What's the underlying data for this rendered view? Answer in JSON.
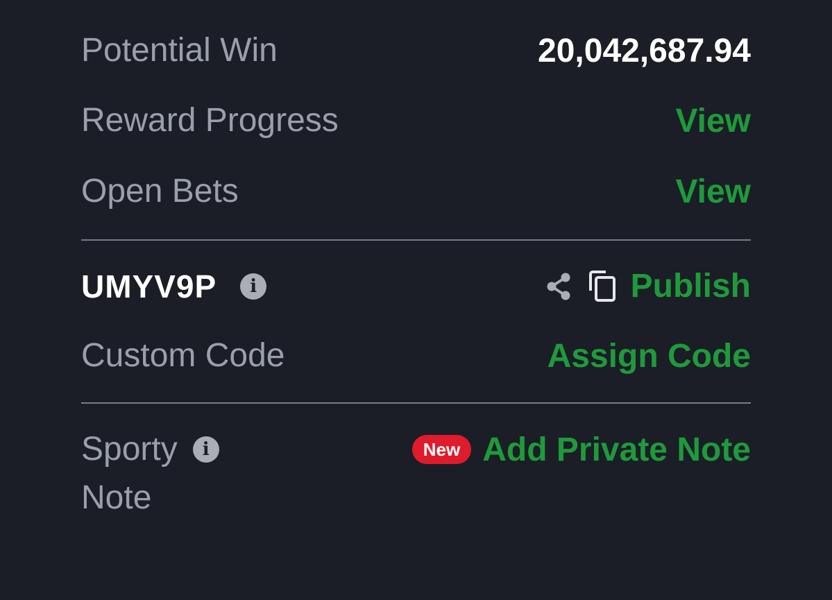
{
  "summary": {
    "potential_win": {
      "label": "Potential Win",
      "value": "20,042,687.94"
    },
    "reward_progress": {
      "label": "Reward Progress",
      "action": "View"
    },
    "open_bets": {
      "label": "Open Bets",
      "action": "View"
    }
  },
  "booking": {
    "code": "UMYV9P",
    "info_icon": "info-icon",
    "share_icon": "share-icon",
    "copy_icon": "copy-icon",
    "publish_label": "Publish",
    "custom_code": {
      "label": "Custom Code",
      "action": "Assign Code"
    }
  },
  "note": {
    "label_line1": "Sporty",
    "label_line2": "Note",
    "info_icon": "info-icon",
    "badge": "New",
    "action": "Add Private Note"
  },
  "colors": {
    "background": "#1b1e26",
    "accent_green": "#1f9a3b",
    "muted_text": "#9aa0ab",
    "badge_red": "#e01b2b"
  }
}
